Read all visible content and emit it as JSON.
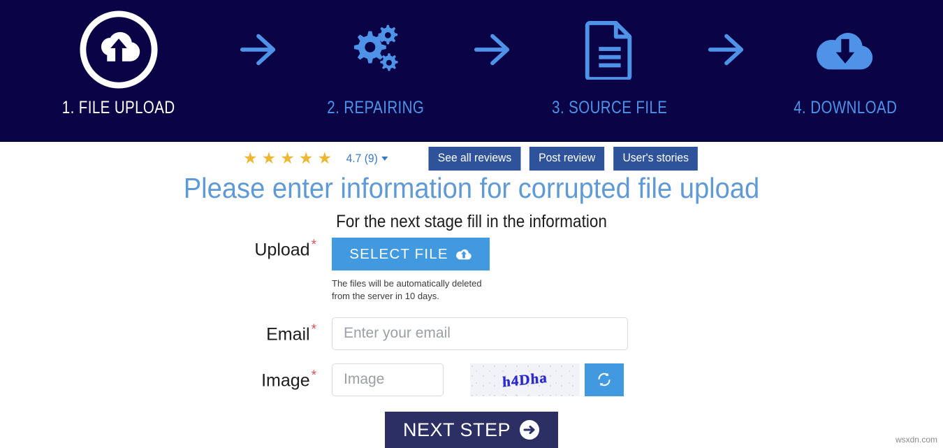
{
  "header": {
    "background_color": "#0a0446",
    "active_color": "#ffffff",
    "inactive_color": "#4f93e8",
    "steps": [
      {
        "label": "1. FILE UPLOAD",
        "icon": "cloud-upload-circle-icon",
        "state": "active"
      },
      {
        "label": "2. REPAIRING",
        "icon": "gears-icon",
        "state": "inactive"
      },
      {
        "label": "3. SOURCE FILE",
        "icon": "document-icon",
        "state": "inactive"
      },
      {
        "label": "4. DOWNLOAD",
        "icon": "cloud-download-icon",
        "state": "inactive"
      }
    ],
    "arrow_icon": "arrow-right-icon"
  },
  "rating": {
    "stars_filled": 5,
    "star_color": "#edb734",
    "score_text": "4.7 (9)",
    "score_color": "#3b78c4",
    "dropdown_icon": "caret-down-icon",
    "buttons": [
      {
        "label": "See all reviews",
        "name": "see-all-reviews-button"
      },
      {
        "label": "Post review",
        "name": "post-review-button"
      },
      {
        "label": "User's stories",
        "name": "user-stories-button"
      }
    ],
    "button_color": "#2e539b"
  },
  "titles": {
    "main": "Please enter information for corrupted file upload",
    "main_color": "#5f9ad6",
    "sub": "For the next stage fill in the information"
  },
  "form": {
    "required_marker": "*",
    "required_color": "#d9534f",
    "upload": {
      "label": "Upload",
      "button_label": "SELECT FILE",
      "button_icon": "cloud-upload-icon",
      "button_color": "#4199e0",
      "hint": "The files will be automatically deleted from the server in 10 days."
    },
    "email": {
      "label": "Email",
      "placeholder": "Enter your email",
      "value": ""
    },
    "image": {
      "label": "Image",
      "placeholder": "Image",
      "value": "",
      "captcha_text": "h4Dha",
      "refresh_icon": "refresh-icon",
      "refresh_color": "#4199e0"
    },
    "submit": {
      "label": "NEXT STEP",
      "icon": "arrow-right-circle-icon",
      "color": "#2c2f63"
    }
  },
  "watermark": "wsxdn.com"
}
